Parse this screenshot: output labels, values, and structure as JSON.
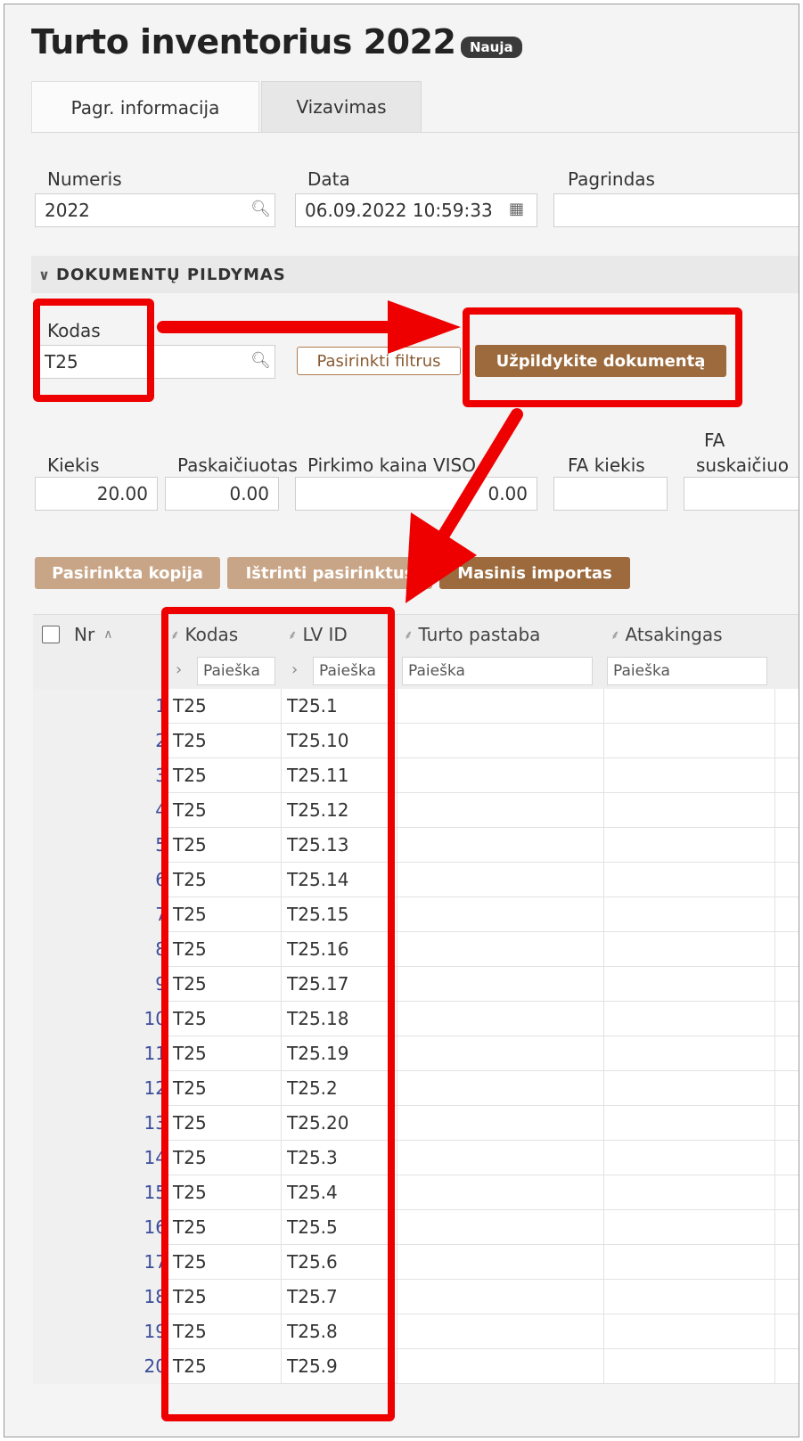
{
  "header": {
    "title": "Turto inventorius 2022",
    "badge": "Nauja"
  },
  "tabs": [
    {
      "label": "Pagr. informacija",
      "active": true
    },
    {
      "label": "Vizavimas",
      "active": false
    }
  ],
  "fields": {
    "numeris": {
      "label": "Numeris",
      "value": "2022"
    },
    "data": {
      "label": "Data",
      "value": "06.09.2022 10:59:33"
    },
    "pagrindas": {
      "label": "Pagrindas",
      "value": ""
    }
  },
  "section": {
    "title": "DOKUMENTŲ PILDYMAS"
  },
  "fill": {
    "kodas_label": "Kodas",
    "kodas_value": "T25",
    "filter_button": "Pasirinkti filtrus",
    "fill_button": "Užpildykite dokumentą"
  },
  "totals": {
    "kiekis_label": "Kiekis",
    "kiekis_value": "20.00",
    "paskaic_label": "Paskaičiuotas",
    "paskaic_value": "0.00",
    "pirkimo_label": "Pirkimo kaina VISO",
    "pirkimo_value": "0.00",
    "fa_kiekis_label": "FA kiekis",
    "fa_kiekis_value": "",
    "fa_susk_label_1": "FA",
    "fa_susk_label_2": "suskaičiuo",
    "fa_susk_value": ""
  },
  "actions": {
    "copy": "Pasirinkta kopija",
    "delete": "Ištrinti pasirinktus",
    "import": "Masinis importas"
  },
  "grid": {
    "columns": {
      "nr": "Nr",
      "kodas": "Kodas",
      "lv_id": "LV ID",
      "turto_pastaba": "Turto pastaba",
      "atsakingas": "Atsakingas"
    },
    "search_placeholder": "Paieška",
    "rows": [
      {
        "nr": "1",
        "kodas": "T25",
        "lv_id": "T25.1"
      },
      {
        "nr": "2",
        "kodas": "T25",
        "lv_id": "T25.10"
      },
      {
        "nr": "3",
        "kodas": "T25",
        "lv_id": "T25.11"
      },
      {
        "nr": "4",
        "kodas": "T25",
        "lv_id": "T25.12"
      },
      {
        "nr": "5",
        "kodas": "T25",
        "lv_id": "T25.13"
      },
      {
        "nr": "6",
        "kodas": "T25",
        "lv_id": "T25.14"
      },
      {
        "nr": "7",
        "kodas": "T25",
        "lv_id": "T25.15"
      },
      {
        "nr": "8",
        "kodas": "T25",
        "lv_id": "T25.16"
      },
      {
        "nr": "9",
        "kodas": "T25",
        "lv_id": "T25.17"
      },
      {
        "nr": "10",
        "kodas": "T25",
        "lv_id": "T25.18"
      },
      {
        "nr": "11",
        "kodas": "T25",
        "lv_id": "T25.19"
      },
      {
        "nr": "12",
        "kodas": "T25",
        "lv_id": "T25.2"
      },
      {
        "nr": "13",
        "kodas": "T25",
        "lv_id": "T25.20"
      },
      {
        "nr": "14",
        "kodas": "T25",
        "lv_id": "T25.3"
      },
      {
        "nr": "15",
        "kodas": "T25",
        "lv_id": "T25.4"
      },
      {
        "nr": "16",
        "kodas": "T25",
        "lv_id": "T25.5"
      },
      {
        "nr": "17",
        "kodas": "T25",
        "lv_id": "T25.6"
      },
      {
        "nr": "18",
        "kodas": "T25",
        "lv_id": "T25.7"
      },
      {
        "nr": "19",
        "kodas": "T25",
        "lv_id": "T25.8"
      },
      {
        "nr": "20",
        "kodas": "T25",
        "lv_id": "T25.9"
      }
    ]
  },
  "colors": {
    "brown": "#9c6a3c",
    "tan": "#c9a587",
    "highlight_red": "#ee0000",
    "row_number": "#3a4c9a"
  }
}
